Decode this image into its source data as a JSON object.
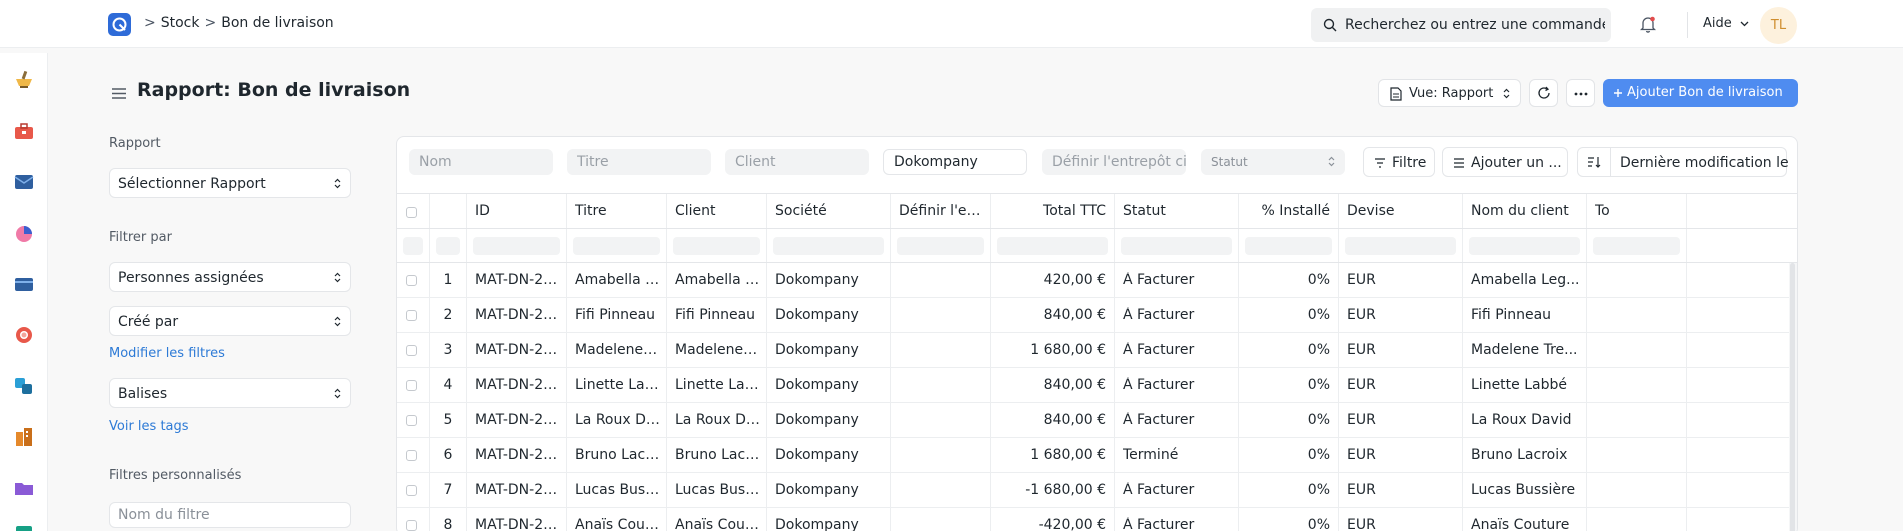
{
  "breadcrumb": {
    "items": [
      "Stock",
      "Bon de livraison"
    ],
    "separator": ">"
  },
  "search": {
    "placeholder": "Recherchez ou entrez une commande"
  },
  "help_label": "Aide",
  "avatar_initials": "TL",
  "rail_icons": [
    "mortar-icon",
    "toolbox-icon",
    "envelope-icon",
    "pie-chart-icon",
    "wallet-icon",
    "lifebuoy-icon",
    "shapes-icon",
    "buildings-icon",
    "folder-icon",
    "book-icon"
  ],
  "page_title": "Rapport: Bon de livraison",
  "actions": {
    "view": "Vue: Rapport",
    "add": "Ajouter Bon de livraison"
  },
  "sidebar": {
    "report_heading": "Rapport",
    "report_select": "Sélectionner Rapport",
    "filter_heading": "Filtrer par",
    "assigned": "Personnes assignées",
    "created_by": "Créé par",
    "edit_filters": "Modifier les filtres",
    "tags": "Balises",
    "view_tags": "Voir les tags",
    "custom_heading": "Filtres personnalisés",
    "custom_placeholder": "Nom du filtre"
  },
  "filters": {
    "name_ph": "Nom",
    "title_ph": "Titre",
    "client_ph": "Client",
    "company_value": "Dokompany",
    "warehouse_ph": "Définir l'entrepôt ci",
    "status_ph": "Statut",
    "filter_btn": "Filtre",
    "add_column_btn": "Ajouter un ...",
    "sort_btn": "Dernière modification le"
  },
  "columns": [
    "ID",
    "Titre",
    "Client",
    "Société",
    "Définir l'entr...",
    "Total TTC",
    "Statut",
    "% Installé",
    "Devise",
    "Nom du client",
    "To"
  ],
  "rows": [
    {
      "n": "1",
      "id": "MAT-DN-202...",
      "title": "Amabella Leg...",
      "client": "Amabella Leg...",
      "company": "Dokompany",
      "warehouse": "",
      "total": "420,00 €",
      "status": "À Facturer",
      "installed": "0%",
      "currency": "EUR",
      "client_name": "Amabella Leg..."
    },
    {
      "n": "2",
      "id": "MAT-DN-202...",
      "title": "Fifi Pinneau",
      "client": "Fifi Pinneau",
      "company": "Dokompany",
      "warehouse": "",
      "total": "840,00 €",
      "status": "À Facturer",
      "installed": "0%",
      "currency": "EUR",
      "client_name": "Fifi Pinneau"
    },
    {
      "n": "3",
      "id": "MAT-DN-202...",
      "title": "Madelene Tre...",
      "client": "Madelene Tre...",
      "company": "Dokompany",
      "warehouse": "",
      "total": "1 680,00 €",
      "status": "À Facturer",
      "installed": "0%",
      "currency": "EUR",
      "client_name": "Madelene Tre..."
    },
    {
      "n": "4",
      "id": "MAT-DN-202...",
      "title": "Linette Labbé",
      "client": "Linette Labbé",
      "company": "Dokompany",
      "warehouse": "",
      "total": "840,00 €",
      "status": "À Facturer",
      "installed": "0%",
      "currency": "EUR",
      "client_name": "Linette Labbé"
    },
    {
      "n": "5",
      "id": "MAT-DN-202...",
      "title": "La Roux David",
      "client": "La Roux David",
      "company": "Dokompany",
      "warehouse": "",
      "total": "840,00 €",
      "status": "À Facturer",
      "installed": "0%",
      "currency": "EUR",
      "client_name": "La Roux David"
    },
    {
      "n": "6",
      "id": "MAT-DN-202...",
      "title": "Bruno Lacroix",
      "client": "Bruno Lacroix",
      "company": "Dokompany",
      "warehouse": "",
      "total": "1 680,00 €",
      "status": "Terminé",
      "installed": "0%",
      "currency": "EUR",
      "client_name": "Bruno Lacroix"
    },
    {
      "n": "7",
      "id": "MAT-DN-202...",
      "title": "Lucas Bussière",
      "client": "Lucas Bussière",
      "company": "Dokompany",
      "warehouse": "",
      "total": "-1 680,00 €",
      "status": "À Facturer",
      "installed": "0%",
      "currency": "EUR",
      "client_name": "Lucas Bussière"
    },
    {
      "n": "8",
      "id": "MAT-DN-202...",
      "title": "Anaïs Couture",
      "client": "Anaïs Couture",
      "company": "Dokompany",
      "warehouse": "",
      "total": "-420,00 €",
      "status": "À Facturer",
      "installed": "0%",
      "currency": "EUR",
      "client_name": "Anaïs Couture"
    }
  ],
  "colors": {
    "primary": "#4f8cf0",
    "link": "#2d7ad6",
    "avatar_bg": "#fdf1dd",
    "avatar_fg": "#cf8e2f"
  }
}
